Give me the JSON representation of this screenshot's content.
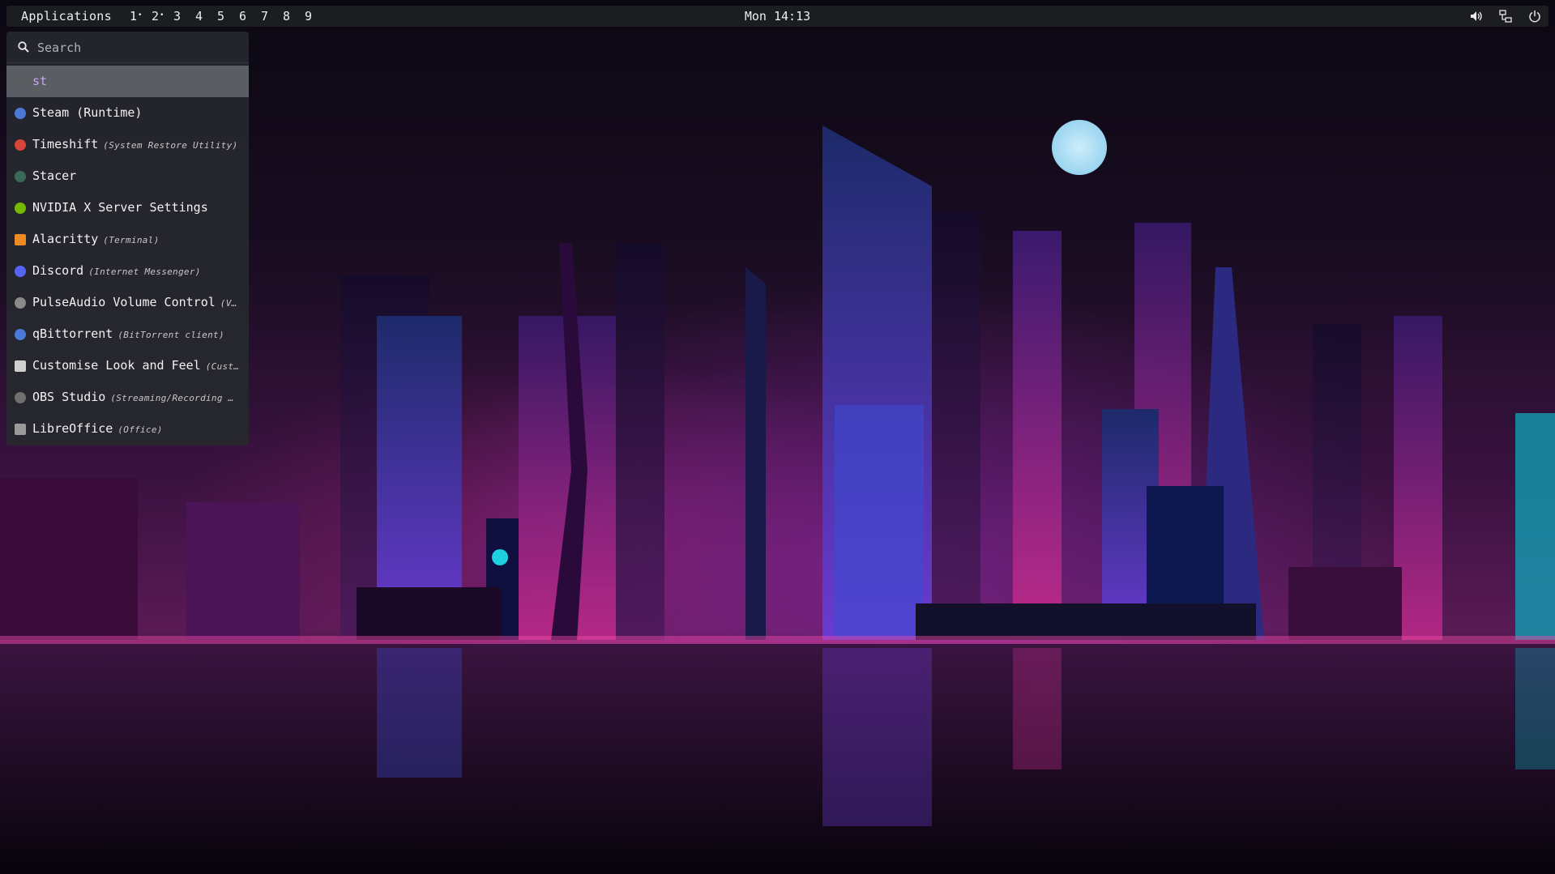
{
  "topbar": {
    "applications_label": "Applications",
    "workspaces": [
      {
        "label": "1",
        "dot": "•"
      },
      {
        "label": "2",
        "dot": "•"
      },
      {
        "label": "3",
        "dot": ""
      },
      {
        "label": "4",
        "dot": ""
      },
      {
        "label": "5",
        "dot": ""
      },
      {
        "label": "6",
        "dot": ""
      },
      {
        "label": "7",
        "dot": ""
      },
      {
        "label": "8",
        "dot": ""
      },
      {
        "label": "9",
        "dot": ""
      }
    ],
    "clock": "Mon 14:13",
    "tray": [
      "volume-icon",
      "network-icon",
      "power-icon"
    ]
  },
  "launcher": {
    "search_placeholder": "Search",
    "search_value": "",
    "results": [
      {
        "name": "st",
        "desc": "",
        "icon": "terminal-icon",
        "color": "#5a5c60",
        "selected": true
      },
      {
        "name": "Steam (Runtime)",
        "desc": "",
        "icon": "steam-icon",
        "color": "#4a7ad8"
      },
      {
        "name": "Timeshift",
        "desc": "(System Restore Utility)",
        "icon": "timeshift-icon",
        "color": "#d8453a"
      },
      {
        "name": "Stacer",
        "desc": "",
        "icon": "stacer-icon",
        "color": "#3a6a5a"
      },
      {
        "name": "NVIDIA X Server Settings",
        "desc": "",
        "icon": "nvidia-icon",
        "color": "#76b900"
      },
      {
        "name": "Alacritty",
        "desc": "(Terminal)",
        "icon": "alacritty-icon",
        "color": "#f08a24"
      },
      {
        "name": "Discord",
        "desc": "(Internet Messenger)",
        "icon": "discord-icon",
        "color": "#5865f2"
      },
      {
        "name": "PulseAudio Volume Control",
        "desc": "(V…",
        "icon": "pulseaudio-icon",
        "color": "#8a8a8a"
      },
      {
        "name": "qBittorrent",
        "desc": "(BitTorrent client)",
        "icon": "qbittorrent-icon",
        "color": "#4a7ad8"
      },
      {
        "name": "Customise Look and Feel",
        "desc": "(Cust…",
        "icon": "appearance-icon",
        "color": "#d0d0d0"
      },
      {
        "name": "OBS Studio",
        "desc": "(Streaming/Recording …",
        "icon": "obs-icon",
        "color": "#707070"
      },
      {
        "name": "LibreOffice",
        "desc": "(Office)",
        "icon": "libreoffice-icon",
        "color": "#9a9a9a"
      }
    ]
  },
  "colors": {
    "topbar_bg": "#1c1e22",
    "launcher_bg": "#26282e",
    "selected_text": "#c4a7f0",
    "moon": "#cdeefb"
  }
}
